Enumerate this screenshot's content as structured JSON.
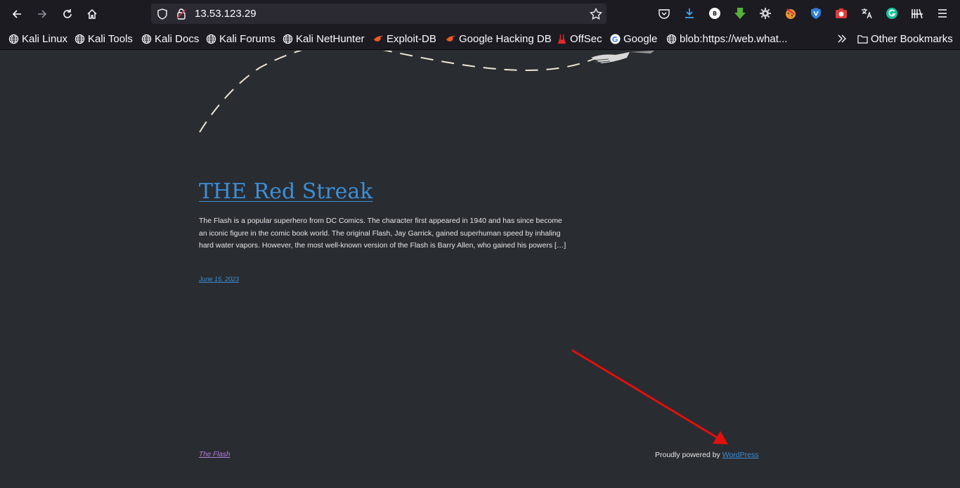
{
  "browser": {
    "url": "13.53.123.29",
    "bookmarks": [
      {
        "label": "Kali Linux",
        "icon": "globe-icon"
      },
      {
        "label": "Kali Tools",
        "icon": "globe-icon"
      },
      {
        "label": "Kali Docs",
        "icon": "globe-icon"
      },
      {
        "label": "Kali Forums",
        "icon": "globe-icon"
      },
      {
        "label": "Kali NetHunter",
        "icon": "globe-icon"
      },
      {
        "label": "Exploit-DB",
        "icon": "exploitdb-icon"
      },
      {
        "label": "Google Hacking DB",
        "icon": "exploitdb-icon"
      },
      {
        "label": "OffSec",
        "icon": "offsec-icon"
      },
      {
        "label": "Google",
        "icon": "google-icon"
      },
      {
        "label": "blob:https://web.what...",
        "icon": "globe-icon"
      }
    ],
    "other_bookmarks": "Other Bookmarks",
    "colors": {
      "chrome": "#1c1b22",
      "urlbar": "#2b2a33",
      "page_bg": "#292c31",
      "link": "#3d8fd6",
      "visited": "#b57edc",
      "arrow": "#e01010"
    }
  },
  "post": {
    "title": "THE Red Streak",
    "excerpt": "The Flash is a popular superhero from DC Comics. The character first appeared in 1940 and has since become an iconic figure in the comic book world. The original Flash, Jay Garrick, gained superhuman speed by inhaling hard water vapors. However, the most well-known version of the Flash is Barry Allen, who gained his powers […]",
    "date": "June 15, 2023"
  },
  "footer": {
    "site_title": "The Flash",
    "powered_prefix": "Proudly powered by ",
    "powered_link": "WordPress"
  }
}
